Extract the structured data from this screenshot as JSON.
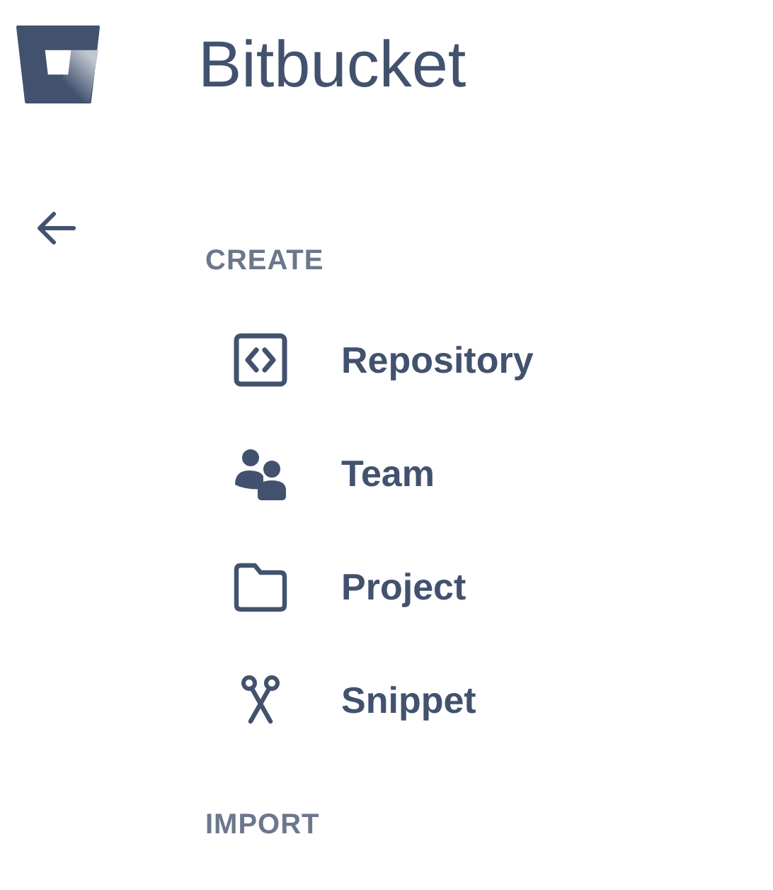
{
  "app": {
    "title": "Bitbucket"
  },
  "sections": [
    {
      "heading": "CREATE",
      "items": [
        {
          "kind": "repository",
          "label": "Repository"
        },
        {
          "kind": "team",
          "label": "Team"
        },
        {
          "kind": "project",
          "label": "Project"
        },
        {
          "kind": "snippet",
          "label": "Snippet"
        }
      ]
    },
    {
      "heading": "IMPORT"
    }
  ]
}
